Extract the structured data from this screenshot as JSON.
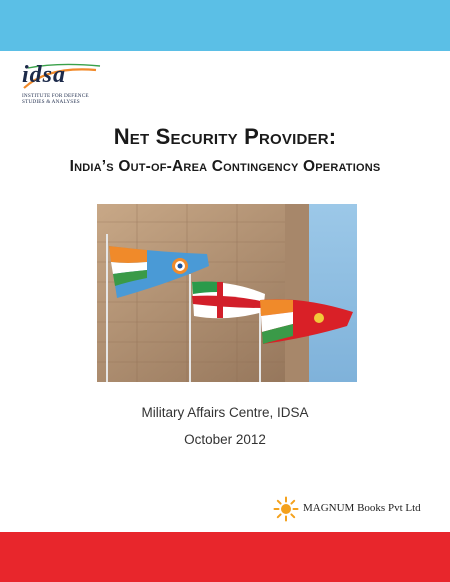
{
  "logo": {
    "wordmark": "idsa",
    "line1": "INSTITUTE FOR DEFENCE",
    "line2": "STUDIES & ANALYSES",
    "icon": "idsa-logo-icon"
  },
  "title": {
    "line1": "Net Security Provider:",
    "line2": "India’s Out-of-Area Contingency Operations"
  },
  "photo": {
    "icon": "flags-photo-icon"
  },
  "imprint": {
    "department": "Military Affairs Centre, IDSA",
    "date": "October 2012"
  },
  "publisher": {
    "name": "MAGNUM Books Pvt Ltd",
    "icon": "sun-icon"
  },
  "colors": {
    "top_band": "#5bbfe6",
    "bottom_band": "#e8262c",
    "sun": "#f4a11c"
  }
}
